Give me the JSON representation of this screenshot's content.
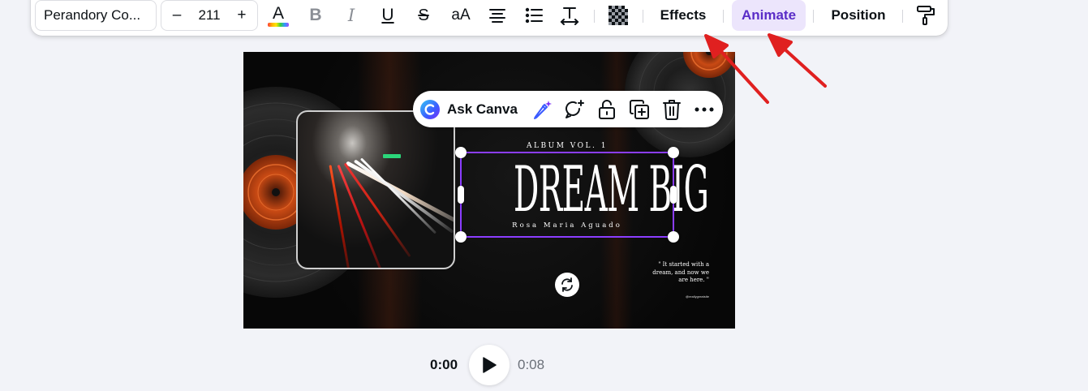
{
  "toolbar": {
    "font_name": "Perandory Co...",
    "font_size": "211",
    "minus_label": "–",
    "plus_label": "+",
    "text_color_glyph": "A",
    "bold_glyph": "B",
    "italic_glyph": "I",
    "underline_glyph": "U",
    "strike_glyph": "S",
    "case_glyph": "aA",
    "effects_label": "Effects",
    "animate_label": "Animate",
    "position_label": "Position",
    "accent_color": "#8b3dff",
    "animate_bg": "#ece5fc",
    "icons": [
      "text-color-icon",
      "bold-icon",
      "italic-icon",
      "underline-icon",
      "strikethrough-icon",
      "letter-case-icon",
      "align-center-icon",
      "list-icon",
      "spacing-icon",
      "transparency-icon",
      "paint-roller-icon"
    ]
  },
  "context_menu": {
    "ask_label": "Ask Canva",
    "icons": [
      "canva-logo-icon",
      "magic-edit-icon",
      "comment-add-icon",
      "lock-icon",
      "duplicate-icon",
      "trash-icon",
      "more-icon"
    ]
  },
  "design": {
    "album_label": "ALBUM VOL. 1",
    "title": "DREAM BIG",
    "artist": "Rosa Maria Aguado",
    "quote": "\" It started with a dream, and now we are here. \"",
    "handle": "@reallygreatsite"
  },
  "playback": {
    "current_time": "0:00",
    "total_time": "0:08"
  },
  "annotation_color": "#e02020"
}
